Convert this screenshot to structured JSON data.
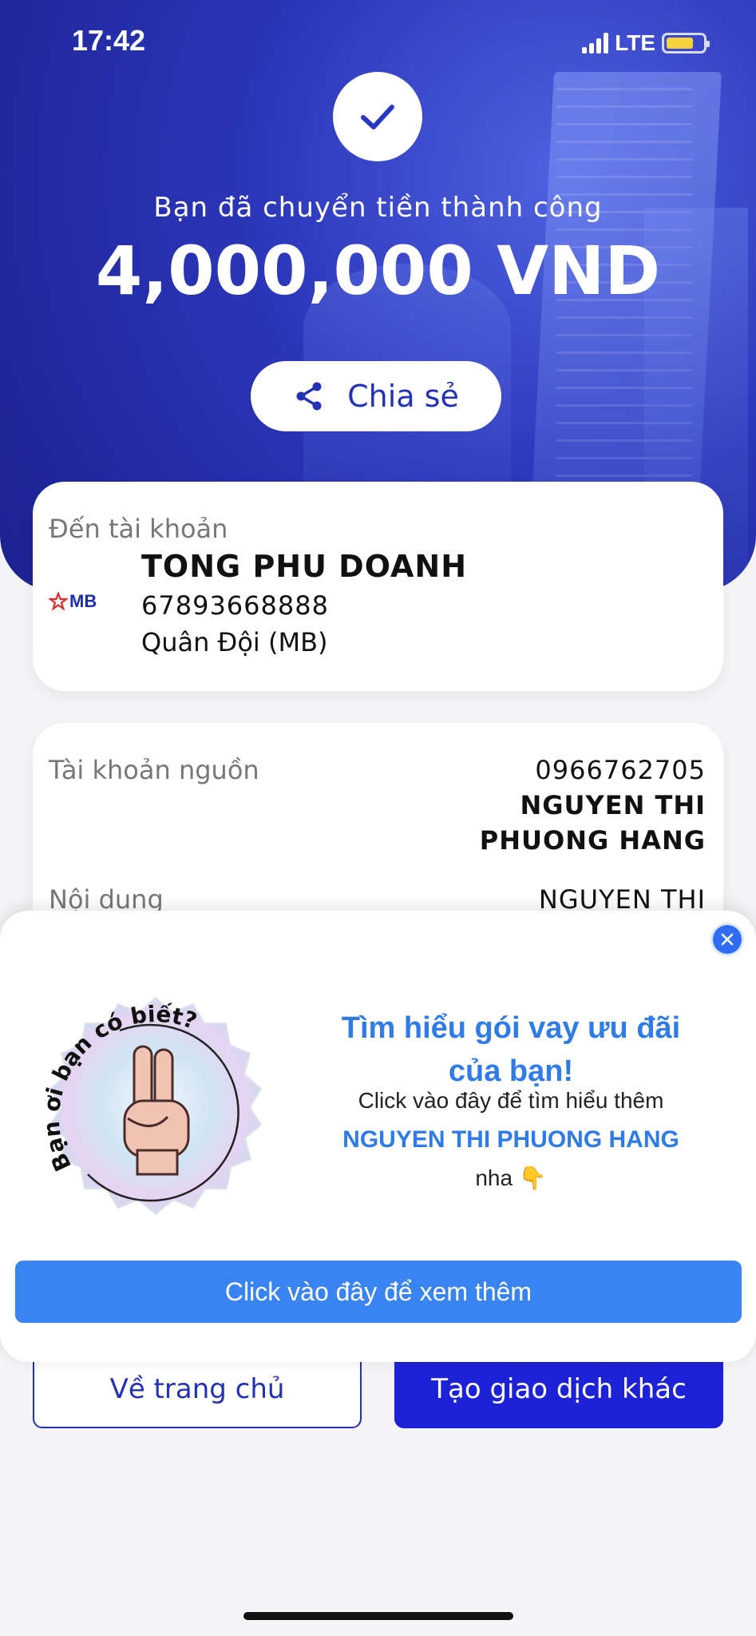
{
  "status_bar": {
    "time": "17:42",
    "network": "LTE"
  },
  "header": {
    "success_message": "Bạn đã chuyển tiền thành công",
    "amount": "4,000,000 VND",
    "share_label": "Chia sẻ"
  },
  "recipient": {
    "label": "Đến tài khoản",
    "bank_logo_text": "MB",
    "name": "TONG PHU DOANH",
    "account_number": "67893668888",
    "bank_name": "Quân Đội (MB)"
  },
  "details": {
    "source_label": "Tài khoản nguồn",
    "source_account": "0966762705",
    "source_name_line1": "NGUYEN THI",
    "source_name_line2": "PHUONG HANG",
    "content_label": "Nội dung",
    "content_value": "NGUYEN THI"
  },
  "popup": {
    "sticker_text": "Bạn ơi bạn có biết?",
    "title": "Tìm hiểu gói vay ưu đãi của bạn!",
    "line1": "Click vào đây để tìm hiểu thêm",
    "name": "NGUYEN THI PHUONG HANG",
    "line3": "nha",
    "emoji": "👇",
    "cta_label": "Click vào đây để xem thêm"
  },
  "actions": {
    "home_label": "Về trang chủ",
    "new_transaction_label": "Tạo giao dịch khác"
  },
  "colors": {
    "primary": "#2331b5",
    "accent_blue": "#2f7be8",
    "cta_blue": "#3a84f2",
    "button_dark": "#1e22d6"
  }
}
